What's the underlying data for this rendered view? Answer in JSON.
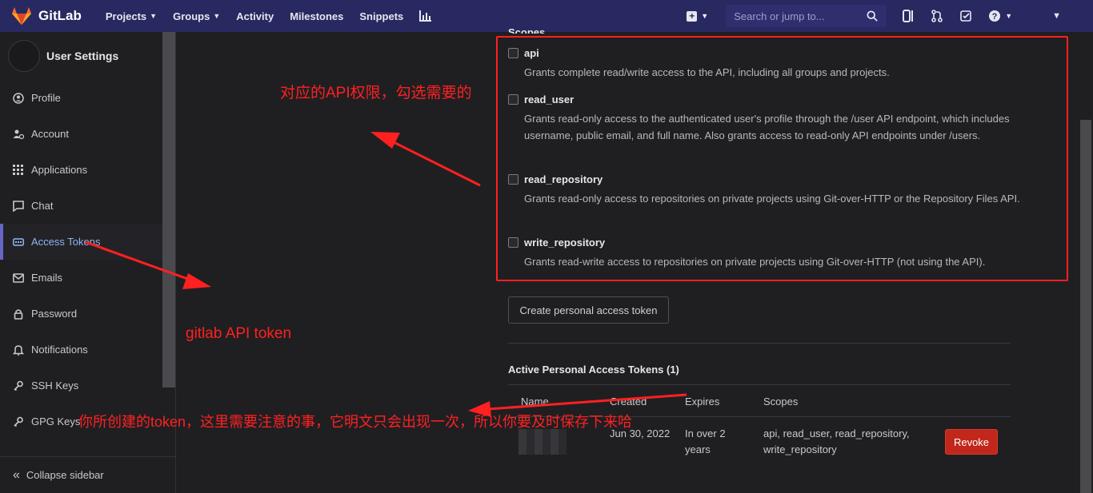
{
  "nav": {
    "brand": "GitLab",
    "links": [
      {
        "label": "Projects",
        "dropdown": true
      },
      {
        "label": "Groups",
        "dropdown": true
      },
      {
        "label": "Activity"
      },
      {
        "label": "Milestones"
      },
      {
        "label": "Snippets"
      }
    ],
    "search_placeholder": "Search or jump to..."
  },
  "sidebar": {
    "title": "User Settings",
    "items": [
      {
        "label": "Profile",
        "icon": "profile-icon"
      },
      {
        "label": "Account",
        "icon": "account-icon"
      },
      {
        "label": "Applications",
        "icon": "applications-icon"
      },
      {
        "label": "Chat",
        "icon": "chat-icon"
      },
      {
        "label": "Access Tokens",
        "icon": "token-icon",
        "active": true
      },
      {
        "label": "Emails",
        "icon": "mail-icon"
      },
      {
        "label": "Password",
        "icon": "lock-icon"
      },
      {
        "label": "Notifications",
        "icon": "bell-icon"
      },
      {
        "label": "SSH Keys",
        "icon": "key-icon"
      },
      {
        "label": "GPG Keys",
        "icon": "key-icon"
      }
    ],
    "collapse_label": "Collapse sidebar"
  },
  "scopes": {
    "label": "Scopes",
    "items": [
      {
        "name": "api",
        "desc": "Grants complete read/write access to the API, including all groups and projects."
      },
      {
        "name": "read_user",
        "desc": "Grants read-only access to the authenticated user's profile through the /user API endpoint, which includes username, public email, and full name. Also grants access to read-only API endpoints under /users."
      },
      {
        "name": "read_repository",
        "desc": "Grants read-only access to repositories on private projects using Git-over-HTTP or the Repository Files API."
      },
      {
        "name": "write_repository",
        "desc": "Grants read-write access to repositories on private projects using Git-over-HTTP (not using the API)."
      }
    ]
  },
  "create_button": "Create personal access token",
  "active_tokens": {
    "title": "Active Personal Access Tokens (1)",
    "headers": {
      "name": "Name",
      "created": "Created",
      "expires": "Expires",
      "scopes": "Scopes"
    },
    "row": {
      "created": "Jun 30, 2022",
      "expires": "In over 2 years",
      "scopes": "api, read_user, read_repository, write_repository",
      "revoke": "Revoke"
    }
  },
  "annotations": {
    "scopes_note": "对应的API权限，勾选需要的",
    "token_note": "gitlab API token",
    "created_note": "你所创建的token，这里需要注意的事，它明文只会出现一次，所以你要及时保存下来哈"
  },
  "colors": {
    "nav_bg": "#292961",
    "annotation": "#ff2020",
    "revoke": "#c1271a",
    "active_link": "#8fb4f2"
  }
}
